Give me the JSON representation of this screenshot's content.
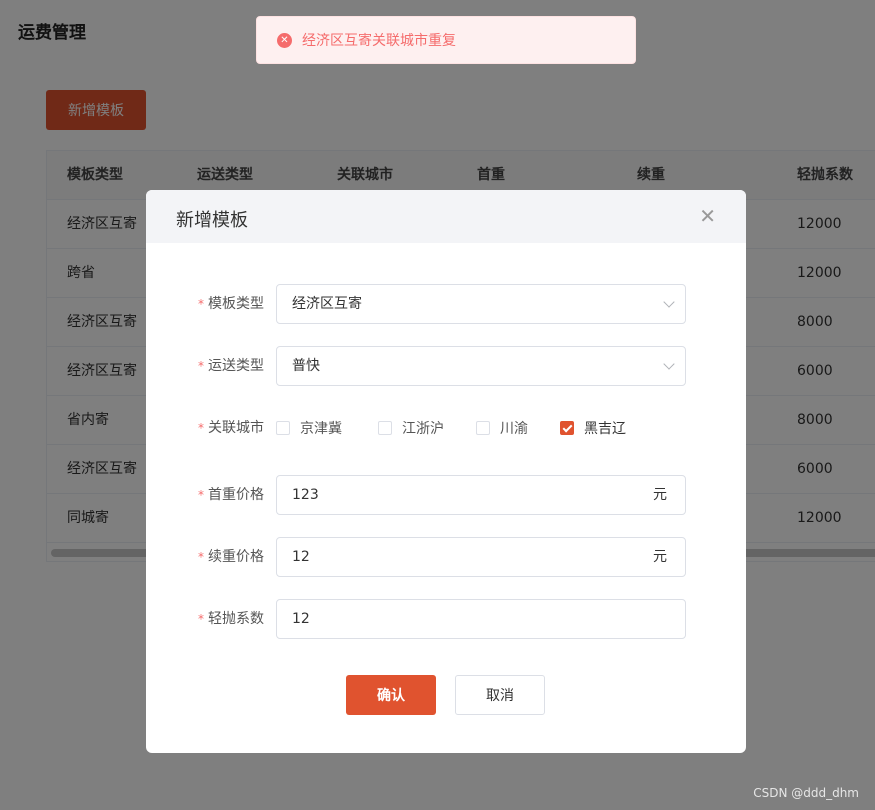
{
  "page": {
    "title": "运费管理"
  },
  "toolbar": {
    "add_label": "新增模板"
  },
  "table": {
    "columns": [
      "模板类型",
      "运送类型",
      "关联城市",
      "首重",
      "续重",
      "轻抛系数"
    ],
    "rows": [
      {
        "type": "经济区互寄",
        "factor": "12000"
      },
      {
        "type": "跨省",
        "factor": "12000"
      },
      {
        "type": "经济区互寄",
        "factor": "8000"
      },
      {
        "type": "经济区互寄",
        "factor": "6000"
      },
      {
        "type": "省内寄",
        "factor": "8000"
      },
      {
        "type": "经济区互寄",
        "factor": "6000"
      },
      {
        "type": "同城寄",
        "factor": "12000"
      }
    ]
  },
  "toast": {
    "icon": "error-circle-icon",
    "message": "经济区互寄关联城市重复",
    "color": "#f56c6c"
  },
  "dialog": {
    "title": "新增模板",
    "fields": {
      "template_type": {
        "label": "模板类型",
        "value": "经济区互寄"
      },
      "shipping_type": {
        "label": "运送类型",
        "value": "普快"
      },
      "cities": {
        "label": "关联城市",
        "options": [
          {
            "label": "京津冀",
            "checked": false
          },
          {
            "label": "江浙沪",
            "checked": false
          },
          {
            "label": "川渝",
            "checked": false
          },
          {
            "label": "黑吉辽",
            "checked": true
          }
        ]
      },
      "first_weight": {
        "label": "首重价格",
        "value": "123",
        "suffix": "元"
      },
      "additional_weight": {
        "label": "续重价格",
        "value": "12",
        "suffix": "元"
      },
      "light_factor": {
        "label": "轻抛系数",
        "value": "12"
      }
    },
    "confirm_label": "确认",
    "cancel_label": "取消"
  },
  "colors": {
    "accent": "#e0532f",
    "error": "#f56c6c"
  },
  "watermark": "CSDN @ddd_dhm"
}
